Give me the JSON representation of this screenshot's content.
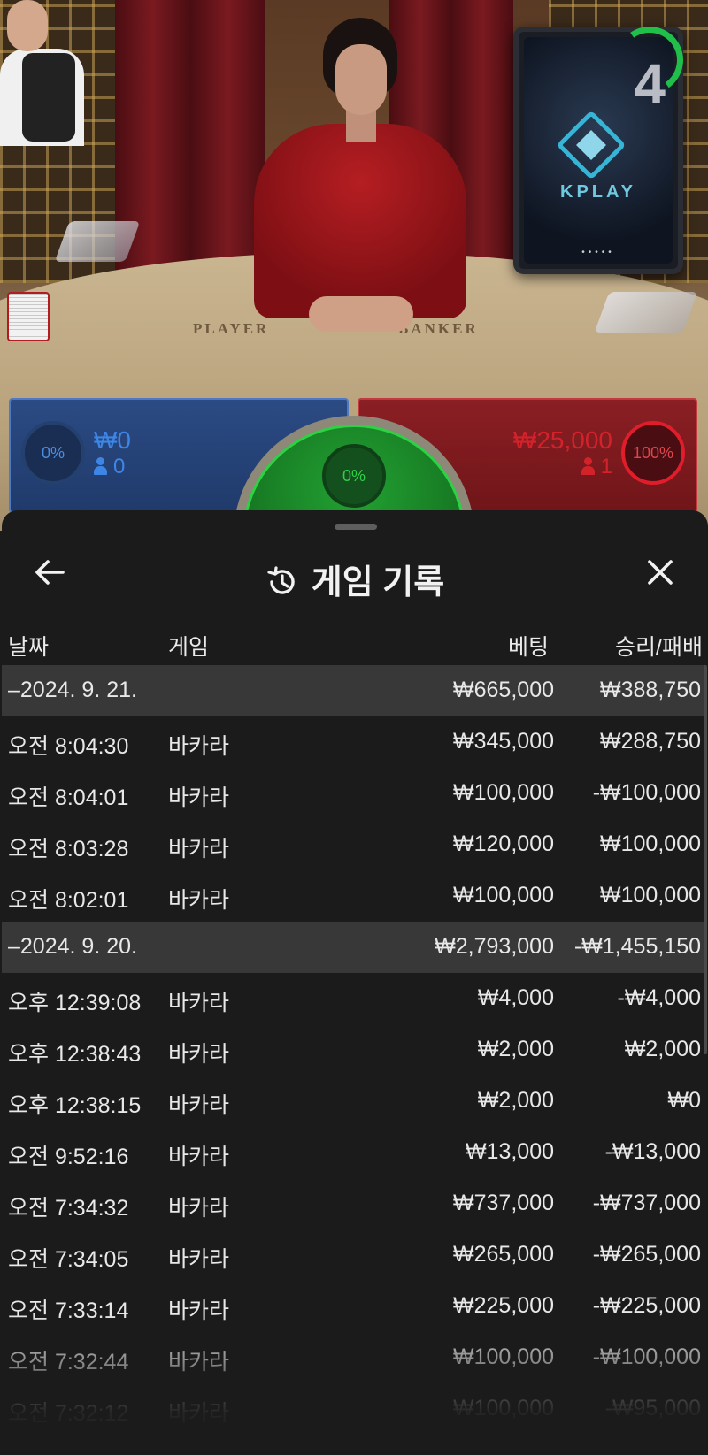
{
  "table": {
    "felt_player": "PLAYER",
    "felt_banker": "BANKER",
    "monitor_countdown": "4",
    "monitor_brand": "KPLAY",
    "monitor_dots": "•••••"
  },
  "bets": {
    "player": {
      "percent": "0%",
      "amount": "₩0",
      "count": "0",
      "color": "#3d86e6"
    },
    "tie": {
      "percent": "0%",
      "color": "#2fd049"
    },
    "banker": {
      "percent": "100%",
      "amount": "₩25,000",
      "count": "1",
      "color": "#d4222b"
    }
  },
  "history": {
    "title": "게임 기록",
    "back_icon": "arrow-left-icon",
    "title_icon": "history-icon",
    "close_icon": "close-icon",
    "columns": {
      "date": "날짜",
      "game": "게임",
      "bet": "베팅",
      "win_loss": "승리/패배"
    },
    "rows": [
      {
        "type": "group",
        "date": "–2024. 9. 21.",
        "game": "",
        "bet": "₩665,000",
        "win_loss": "₩388,750"
      },
      {
        "type": "item",
        "date": "오전 8:04:30",
        "game": "바카라",
        "bet": "₩345,000",
        "win_loss": "₩288,750"
      },
      {
        "type": "item",
        "date": "오전 8:04:01",
        "game": "바카라",
        "bet": "₩100,000",
        "win_loss": "-₩100,000"
      },
      {
        "type": "item",
        "date": "오전 8:03:28",
        "game": "바카라",
        "bet": "₩120,000",
        "win_loss": "₩100,000"
      },
      {
        "type": "item",
        "date": "오전 8:02:01",
        "game": "바카라",
        "bet": "₩100,000",
        "win_loss": "₩100,000"
      },
      {
        "type": "group",
        "date": "–2024. 9. 20.",
        "game": "",
        "bet": "₩2,793,000",
        "win_loss": "-₩1,455,150"
      },
      {
        "type": "item",
        "date": "오후 12:39:08",
        "game": "바카라",
        "bet": "₩4,000",
        "win_loss": "-₩4,000"
      },
      {
        "type": "item",
        "date": "오후 12:38:43",
        "game": "바카라",
        "bet": "₩2,000",
        "win_loss": "₩2,000"
      },
      {
        "type": "item",
        "date": "오후 12:38:15",
        "game": "바카라",
        "bet": "₩2,000",
        "win_loss": "₩0"
      },
      {
        "type": "item",
        "date": "오전 9:52:16",
        "game": "바카라",
        "bet": "₩13,000",
        "win_loss": "-₩13,000"
      },
      {
        "type": "item",
        "date": "오전 7:34:32",
        "game": "바카라",
        "bet": "₩737,000",
        "win_loss": "-₩737,000"
      },
      {
        "type": "item",
        "date": "오전 7:34:05",
        "game": "바카라",
        "bet": "₩265,000",
        "win_loss": "-₩265,000"
      },
      {
        "type": "item",
        "date": "오전 7:33:14",
        "game": "바카라",
        "bet": "₩225,000",
        "win_loss": "-₩225,000"
      },
      {
        "type": "item",
        "date": "오전 7:32:44",
        "game": "바카라",
        "bet": "₩100,000",
        "win_loss": "-₩100,000"
      },
      {
        "type": "item",
        "date": "오전 7:32:12",
        "game": "바카라",
        "bet": "₩100,000",
        "win_loss": "-₩95,000"
      }
    ]
  }
}
